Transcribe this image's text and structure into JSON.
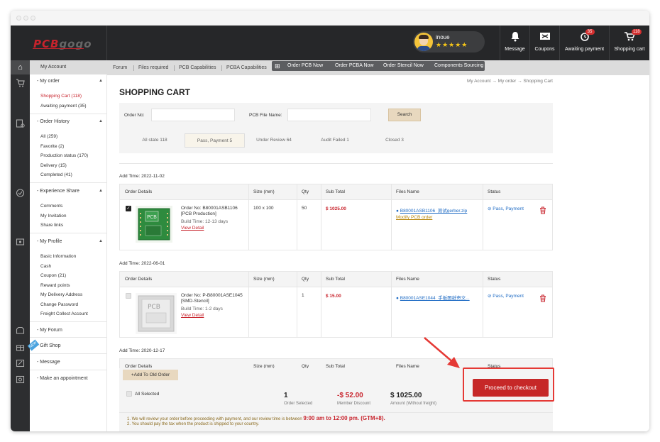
{
  "header": {
    "logo": {
      "main": "PCB",
      "accent": "gogo"
    },
    "user": {
      "name": "inoue",
      "stars": "★★★★★"
    },
    "icons": [
      {
        "label": "Message",
        "badge": ""
      },
      {
        "label": "Coupons",
        "badge": ""
      },
      {
        "label": "Awaiting payment",
        "badge": "35"
      },
      {
        "label": "Shopping cart",
        "badge": "118"
      }
    ]
  },
  "sidebar": {
    "my_account": "My Account",
    "sections": {
      "my_order": {
        "label": "- My order",
        "items": [
          "Shopping Cart (118)",
          "Awaiting payment (35)"
        ]
      },
      "order_history": {
        "label": "- Order History",
        "items": [
          "All (259)",
          "Favorite (2)",
          "Production status (170)",
          "Delivery (15)",
          "Completed (41)"
        ]
      },
      "experience_share": {
        "label": "- Experience Share",
        "items": [
          "Comments",
          "My Invitation",
          "Share links"
        ]
      },
      "my_profile": {
        "label": "- My Profile",
        "items": [
          "Basic Information",
          "Cash",
          "Coupon (21)",
          "Reward points",
          "My Delivery Address",
          "Change Password",
          "Freight Collect Account"
        ]
      },
      "my_forum": {
        "label": "- My Forum"
      },
      "gift_shop": {
        "label": "- Gift Shop",
        "tag": "NEW"
      },
      "message": {
        "label": "- Message"
      },
      "appointment": {
        "label": "- Make an appointment"
      }
    }
  },
  "nav": {
    "links": [
      "Forum",
      "Files required",
      "PCB Capabilities",
      "PCBA Capabilities"
    ],
    "actions": [
      "Order PCB Now",
      "Order PCBA Now",
      "Order Stencil Now",
      "Components Sourcing"
    ]
  },
  "breadcrumb": "My Account → My order → Shopping Cart",
  "page_title": "SHOPPING CART",
  "search": {
    "order_no_label": "Order No:",
    "order_no_value": "",
    "file_label": "PCB File Name:",
    "file_value": "",
    "button": "Search"
  },
  "tabs": [
    "All state 118",
    "Pass, Payment 5",
    "Under Review 64",
    "Audit Failed 1",
    "Closed 3"
  ],
  "columns": [
    "Order Details",
    "Size (mm)",
    "Qty",
    "Sub Total",
    "Files Name",
    "Status"
  ],
  "orders": [
    {
      "add_time": "Add Time: 2022-11-02",
      "order_no": "Order No: B80001ASB1106",
      "type": "[PCB Production]",
      "build_time": "Build Time: 12-13 days",
      "view": "View Detail",
      "size": "100 x 100",
      "qty": "50",
      "subtotal": "$ 1025.00",
      "file": "B80001ASB1106_测试gerber.zip",
      "file_action": "Modify PCB order",
      "status": "Pass, Payment",
      "checked": true
    },
    {
      "add_time": "Add Time: 2022-06-01",
      "order_no": "Order No: P-B80001ASE1045",
      "type": "[SMD-Stencil]",
      "build_time": "Build Time: 1-2 days",
      "view": "View Detail",
      "size": "",
      "qty": "1",
      "subtotal": "$ 15.00",
      "file": "B80001ASE1044_手板图纸寄文...",
      "file_action": "",
      "status": "Pass, Payment",
      "checked": false
    },
    {
      "add_time": "Add Time: 2020-12-17"
    }
  ],
  "summary": {
    "add_old": "+Add To Old Order",
    "all_selected": "All Selected",
    "selected_count": "1",
    "selected_label": "Order Selected",
    "discount": "-$ 52.00",
    "discount_label": "Member Discount",
    "amount": "$ 1025.00",
    "amount_label": "Amount (Without freight)",
    "checkout": "Proceed to checkout",
    "note1_pre": "1. We will review your order before proceeding with payment, and our review time is between ",
    "note1_bold": "9:00 am to 12:00 pm. (GTM+8).",
    "note2": "2. You should pay the tax when the product is shipped to your country."
  },
  "colors": {
    "accent": "#c8232c",
    "topbar": "#262729",
    "link": "#1e6bc4"
  }
}
